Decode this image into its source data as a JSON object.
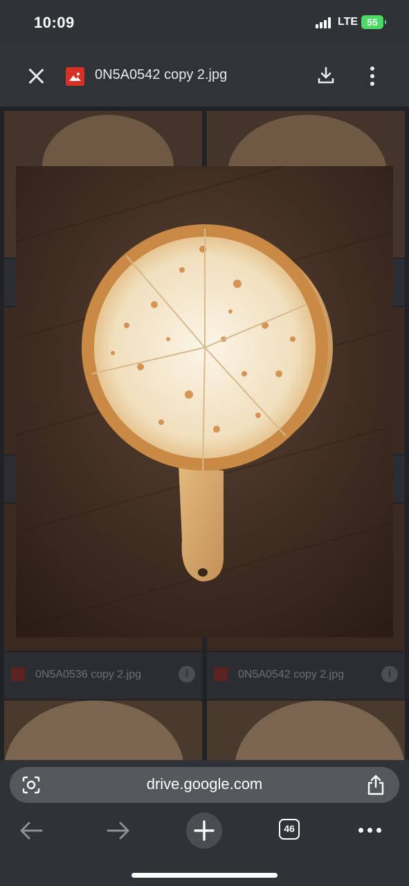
{
  "status_bar": {
    "time": "10:09",
    "network": "LTE",
    "battery": "55"
  },
  "viewer": {
    "file_name": "0N5A0542 copy 2.jpg",
    "icons": {
      "close": "close-icon",
      "file_type": "image-file-icon",
      "download": "download-icon",
      "more": "more-vert-icon"
    }
  },
  "background_grid": {
    "items": [
      {
        "label": "0N5A0536 copy 2.jpg"
      },
      {
        "label": "0N5A0542 copy 2.jpg"
      }
    ]
  },
  "photo": {
    "subject": "cheese pizza on wooden peel",
    "colors": {
      "table": "#3b2a20",
      "peel": "#d7ab6f",
      "crust": "#c98a45",
      "cheese": "#f3e6cf"
    }
  },
  "browser": {
    "url": "drive.google.com",
    "tab_count": "46",
    "icons": {
      "lens": "google-lens-icon",
      "share": "share-icon",
      "back": "back-arrow-icon",
      "forward": "forward-arrow-icon",
      "new_tab": "plus-icon",
      "tabs": "tabs-icon",
      "menu": "more-horiz-icon"
    }
  }
}
